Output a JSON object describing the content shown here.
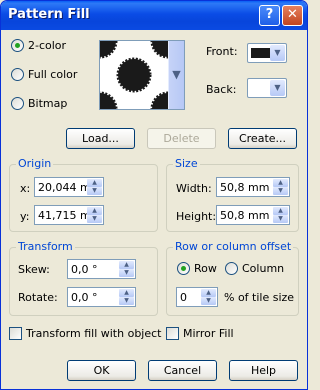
{
  "window": {
    "title": "Pattern Fill",
    "help_glyph": "?",
    "close_glyph": "✕"
  },
  "pattern_type": {
    "options": [
      {
        "label": "2-color",
        "checked": true
      },
      {
        "label": "Full color",
        "checked": false
      },
      {
        "label": "Bitmap",
        "checked": false
      }
    ]
  },
  "colors": {
    "front_label": "Front:",
    "front_color": "#1A1A1A",
    "back_label": "Back:",
    "back_color": "#FFFFFF"
  },
  "buttons": {
    "load": "Load...",
    "delete": "Delete",
    "create": "Create..."
  },
  "origin": {
    "title": "Origin",
    "x_label": "x:",
    "x_value": "20,044 m",
    "y_label": "y:",
    "y_value": "41,715 m"
  },
  "size": {
    "title": "Size",
    "width_label": "Width:",
    "width_value": "50,8 mm",
    "height_label": "Height:",
    "height_value": "50,8 mm"
  },
  "transform": {
    "title": "Transform",
    "skew_label": "Skew:",
    "skew_value": "0,0 °",
    "rotate_label": "Rotate:",
    "rotate_value": "0,0 °"
  },
  "offset": {
    "title": "Row or column offset",
    "row_label": "Row",
    "row_checked": true,
    "column_label": "Column",
    "column_checked": false,
    "value": "0",
    "suffix": "% of tile size"
  },
  "checkboxes": {
    "transform_fill": "Transform fill with object",
    "mirror_fill": "Mirror Fill"
  },
  "footer": {
    "ok": "OK",
    "cancel": "Cancel",
    "help": "Help"
  }
}
